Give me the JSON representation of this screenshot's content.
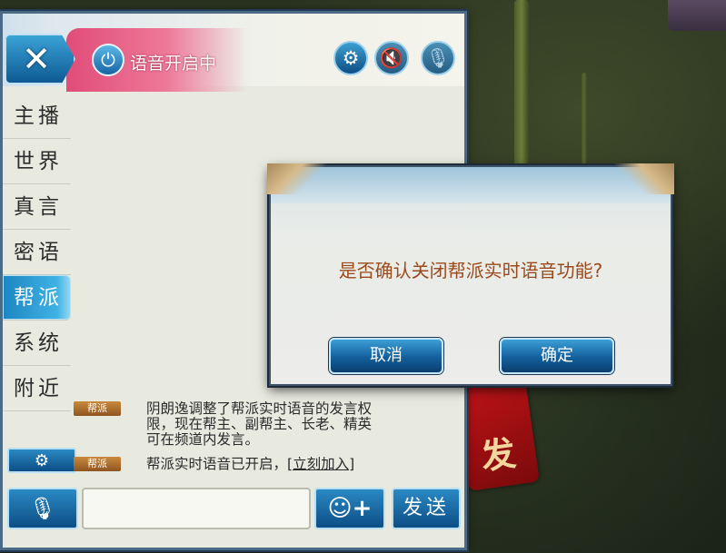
{
  "header": {
    "close_symbol": "✕",
    "voice_status": "语音开启中",
    "icons": [
      "power-icon",
      "gear-icon",
      "speaker-mute-icon",
      "microphone-mute-icon"
    ]
  },
  "sidebar": {
    "items": [
      {
        "label": "主播",
        "active": false
      },
      {
        "label": "世界",
        "active": false
      },
      {
        "label": "真言",
        "active": false
      },
      {
        "label": "密语",
        "active": false
      },
      {
        "label": "帮派",
        "active": true
      },
      {
        "label": "系统",
        "active": false
      },
      {
        "label": "附近",
        "active": false
      }
    ]
  },
  "messages": [
    {
      "channel": "帮派",
      "lines": [
        "阴朗逸调整了帮派实时语音的发言权",
        "限，现在帮主、副帮主、长老、精英",
        "可在频道内发言。"
      ]
    },
    {
      "channel": "帮派",
      "text": "帮派实时语音已开启，",
      "link": "[立刻加入]"
    }
  ],
  "bottom": {
    "input_value": "",
    "send_label": "发送",
    "emoji_symbol": "☺+"
  },
  "dialog": {
    "message": "是否确认关闭帮派实时语音功能?",
    "cancel_label": "取消",
    "confirm_label": "确定"
  },
  "background": {
    "sign_text": "发"
  },
  "colors": {
    "accent_blue": "#1c86c2",
    "header_pink": "#e04d78",
    "dialog_text": "#9a4a1c",
    "badge": "#a76a2c"
  }
}
